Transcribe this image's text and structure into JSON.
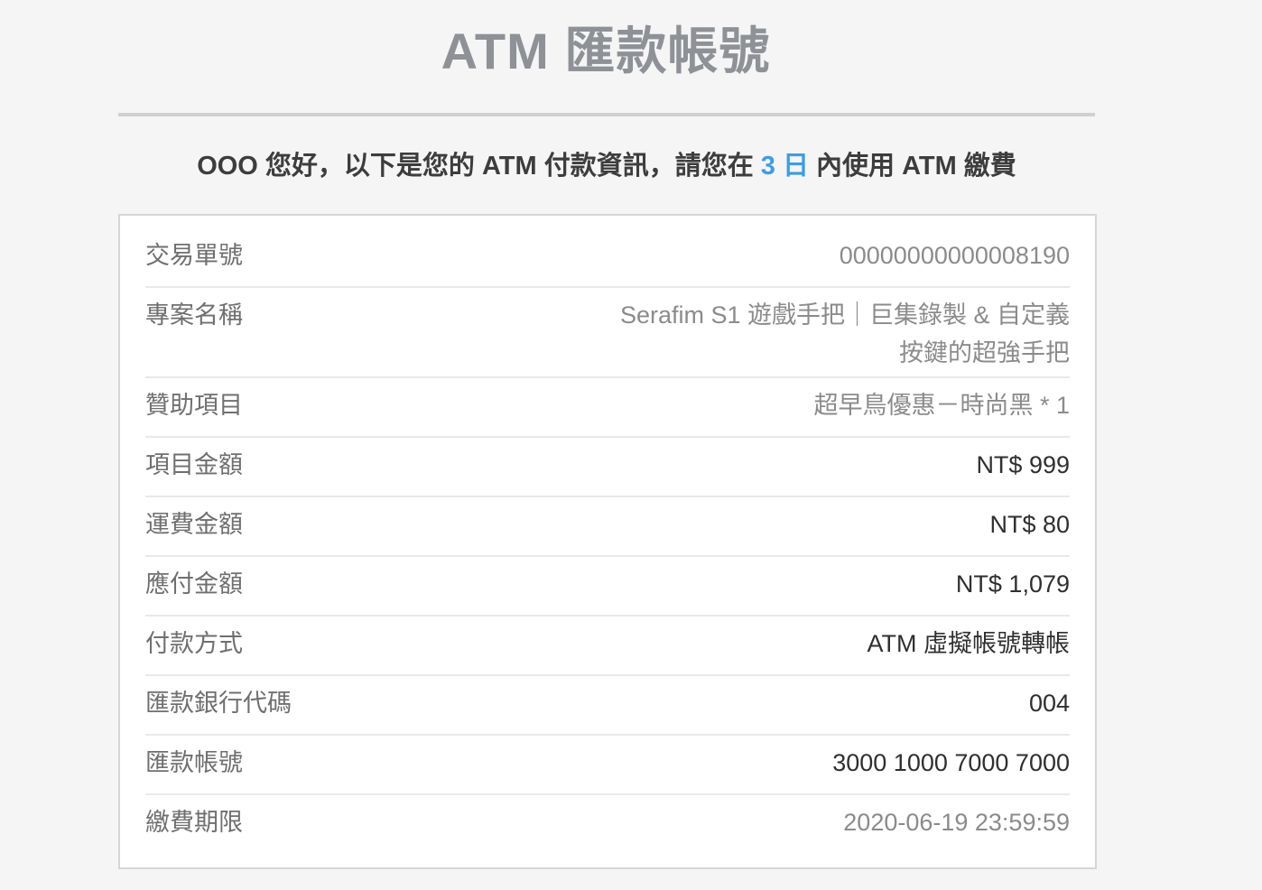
{
  "page": {
    "title": "ATM 匯款帳號"
  },
  "greeting": {
    "prefix": "OOO 您好，以下是您的 ATM 付款資訊，請您在 ",
    "days": "3 日",
    "suffix": " 內使用 ATM 繳費",
    "days_color": "#3d9de3"
  },
  "details": {
    "transaction_no": {
      "label": "交易單號",
      "value": "00000000000008190"
    },
    "project_name": {
      "label": "專案名稱",
      "value": "Serafim S1 遊戲手把｜巨集錄製 & 自定義按鍵的超強手把"
    },
    "sponsor_item": {
      "label": "贊助項目",
      "value": "超早鳥優惠－時尚黑 * 1"
    },
    "item_amount": {
      "label": "項目金額",
      "value": "NT$ 999"
    },
    "shipping_fee": {
      "label": "運費金額",
      "value": "NT$ 80"
    },
    "amount_due": {
      "label": "應付金額",
      "value": "NT$ 1,079"
    },
    "payment_method": {
      "label": "付款方式",
      "value": "ATM 虛擬帳號轉帳"
    },
    "bank_code": {
      "label": "匯款銀行代碼",
      "value": "004"
    },
    "account_no": {
      "label": "匯款帳號",
      "value": "3000 1000 7000 7000"
    },
    "payment_deadline": {
      "label": "繳費期限",
      "value": "2020-06-19 23:59:59"
    }
  }
}
